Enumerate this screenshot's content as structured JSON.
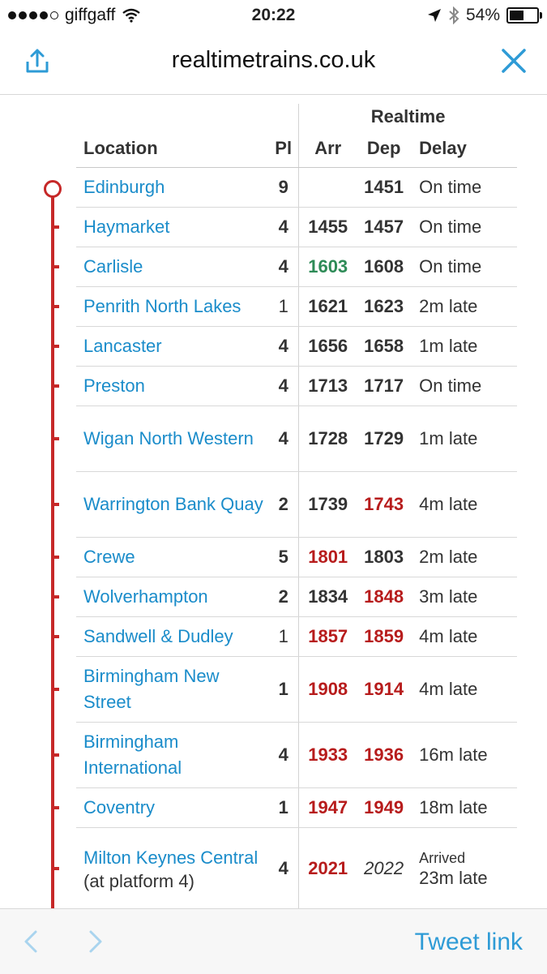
{
  "status": {
    "carrier": "giffgaff",
    "time": "20:22",
    "battery": "54%",
    "battery_level": 0.54,
    "icons": [
      "signal-dots-icon",
      "wifi-icon",
      "location-arrow-icon",
      "bluetooth-icon",
      "battery-icon"
    ]
  },
  "nav": {
    "title": "realtimetrains.co.uk"
  },
  "table": {
    "group_header": "Realtime",
    "columns": {
      "location": "Location",
      "pl": "Pl",
      "arr": "Arr",
      "dep": "Dep",
      "delay": "Delay"
    },
    "rows": [
      {
        "location": "Edinburgh",
        "pl": "9",
        "arr": "",
        "dep": "1451",
        "delay": "On time"
      },
      {
        "location": "Haymarket",
        "pl": "4",
        "arr": "1455",
        "dep": "1457",
        "delay": "On time"
      },
      {
        "location": "Carlisle",
        "pl": "4",
        "arr": "1603",
        "dep": "1608",
        "delay": "On time"
      },
      {
        "location": "Penrith North Lakes",
        "pl": "1",
        "arr": "1621",
        "dep": "1623",
        "delay": "2m late"
      },
      {
        "location": "Lancaster",
        "pl": "4",
        "arr": "1656",
        "dep": "1658",
        "delay": "1m late"
      },
      {
        "location": "Preston",
        "pl": "4",
        "arr": "1713",
        "dep": "1717",
        "delay": "On time"
      },
      {
        "location": "Wigan North Western",
        "pl": "4",
        "arr": "1728",
        "dep": "1729",
        "delay": "1m late"
      },
      {
        "location": "Warrington Bank Quay",
        "pl": "2",
        "arr": "1739",
        "dep": "1743",
        "delay": "4m late"
      },
      {
        "location": "Crewe",
        "pl": "5",
        "arr": "1801",
        "dep": "1803",
        "delay": "2m late"
      },
      {
        "location": "Wolverhampton",
        "pl": "2",
        "arr": "1834",
        "dep": "1848",
        "delay": "3m late"
      },
      {
        "location": "Sandwell & Dudley",
        "pl": "1",
        "arr": "1857",
        "dep": "1859",
        "delay": "4m late"
      },
      {
        "location": "Birmingham New Street",
        "pl": "1",
        "arr": "1908",
        "dep": "1914",
        "delay": "4m late"
      },
      {
        "location": "Birmingham International",
        "pl": "4",
        "arr": "1933",
        "dep": "1936",
        "delay": "16m late"
      },
      {
        "location": "Coventry",
        "pl": "1",
        "arr": "1947",
        "dep": "1949",
        "delay": "18m late"
      },
      {
        "location": "Milton Keynes Central",
        "location_extra": "(at platform 4)",
        "pl": "4",
        "arr": "2021",
        "dep": "2022",
        "delay_status": "Arrived",
        "delay": "23m late"
      }
    ]
  },
  "colors": {
    "link": "#1a8cca",
    "late": "#b71c1c",
    "early": "#2e8b57",
    "rail": "#c62828",
    "accent": "#2e9bd6"
  },
  "toolbar": {
    "tweet_label": "Tweet link"
  }
}
